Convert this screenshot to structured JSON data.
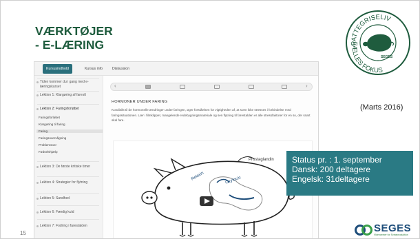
{
  "slide": {
    "title_line1": "VÆRKTØJER",
    "title_line2": "- E-LÆRING",
    "number": "15",
    "date_note": "(Marts 2016)",
    "status": {
      "line1": "Status pr. : 1. september",
      "line2": "Dansk: 200 deltagere",
      "line3": "Engelsk: 31deltagere"
    }
  },
  "logos": {
    "seal_text_top": "PATTEGRISELIV",
    "seal_text_bottom": "FÆLLES FOKUS",
    "seal_sub": "SEGES",
    "seges_word": "SEGES",
    "seges_sub": "Videncenter for Svineproduktion"
  },
  "screenshot": {
    "tabs": [
      "Kursusindhold",
      "Kursus info",
      "Diskussion"
    ],
    "sidebar": [
      {
        "label": "Tiden kommer du i gang med e-læringskurset",
        "type": "item"
      },
      {
        "label": "Lektion 1: Klargøring af farestí",
        "type": "item"
      },
      {
        "label": "Lektion 2: Faringsforløbet",
        "type": "head"
      },
      {
        "label": "Faringsforløbet",
        "type": "sub"
      },
      {
        "label": "Klargøring til faring",
        "type": "sub"
      },
      {
        "label": "Faring",
        "type": "sub",
        "active": true
      },
      {
        "label": "Faringsovervågning",
        "type": "sub"
      },
      {
        "label": "Problemsoer",
        "type": "sub"
      },
      {
        "label": "Fødselshjælp",
        "type": "sub"
      },
      {
        "label": "Lektion 3: De første kritiske timer",
        "type": "item"
      },
      {
        "label": "Lektion 4: Strategier for flytning",
        "type": "item"
      },
      {
        "label": "Lektion 5: Sundhed",
        "type": "item"
      },
      {
        "label": "Lektion 6: Færdig kuld",
        "type": "item"
      },
      {
        "label": "Lektion 7: Fodring i farestalden",
        "type": "item"
      }
    ],
    "section_title": "HORMONER UNDER FARING",
    "section_body": "Kondisikt til de hormonelle ændringer under faringen, øger forståelsen for vigtigheden af, at soen ikke stresses i forbindelse med faringssituationen. Lær i filmklippet, mangelende redebygningsmateriale og sen flytning til farestalden er alle stressfaktorer for en so, der snart skal fare.",
    "video_labels": {
      "gland": "Prostaglandin",
      "hormone1": "Oxytocin",
      "hormone2": "Relaxin"
    }
  }
}
